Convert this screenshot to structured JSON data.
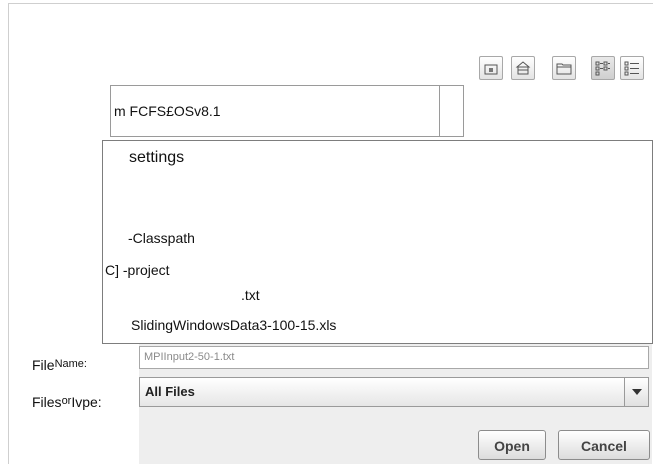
{
  "toolbar": {
    "buttons": [
      {
        "icon": "up-folder-icon"
      },
      {
        "icon": "home-icon"
      },
      {
        "icon": "new-folder-icon"
      },
      {
        "icon": "list-view-icon"
      },
      {
        "icon": "details-view-icon"
      }
    ]
  },
  "look_in": {
    "value": "m FCFS£OSv8.1"
  },
  "file_list": {
    "items": [
      "settings",
      "-Classpath",
      "C] -project",
      ".txt",
      "SlidingWindowsData3-100-15.xls"
    ]
  },
  "file_name": {
    "label_main": "File",
    "label_small": "Name:",
    "value": "MPIInput2-50-1.txt"
  },
  "file_type": {
    "label_main": "Files",
    "label_small": "or",
    "label_end": "Ivpe:",
    "value": "All Files"
  },
  "actions": {
    "open_label": "Open",
    "cancel_label": "Cancel"
  }
}
